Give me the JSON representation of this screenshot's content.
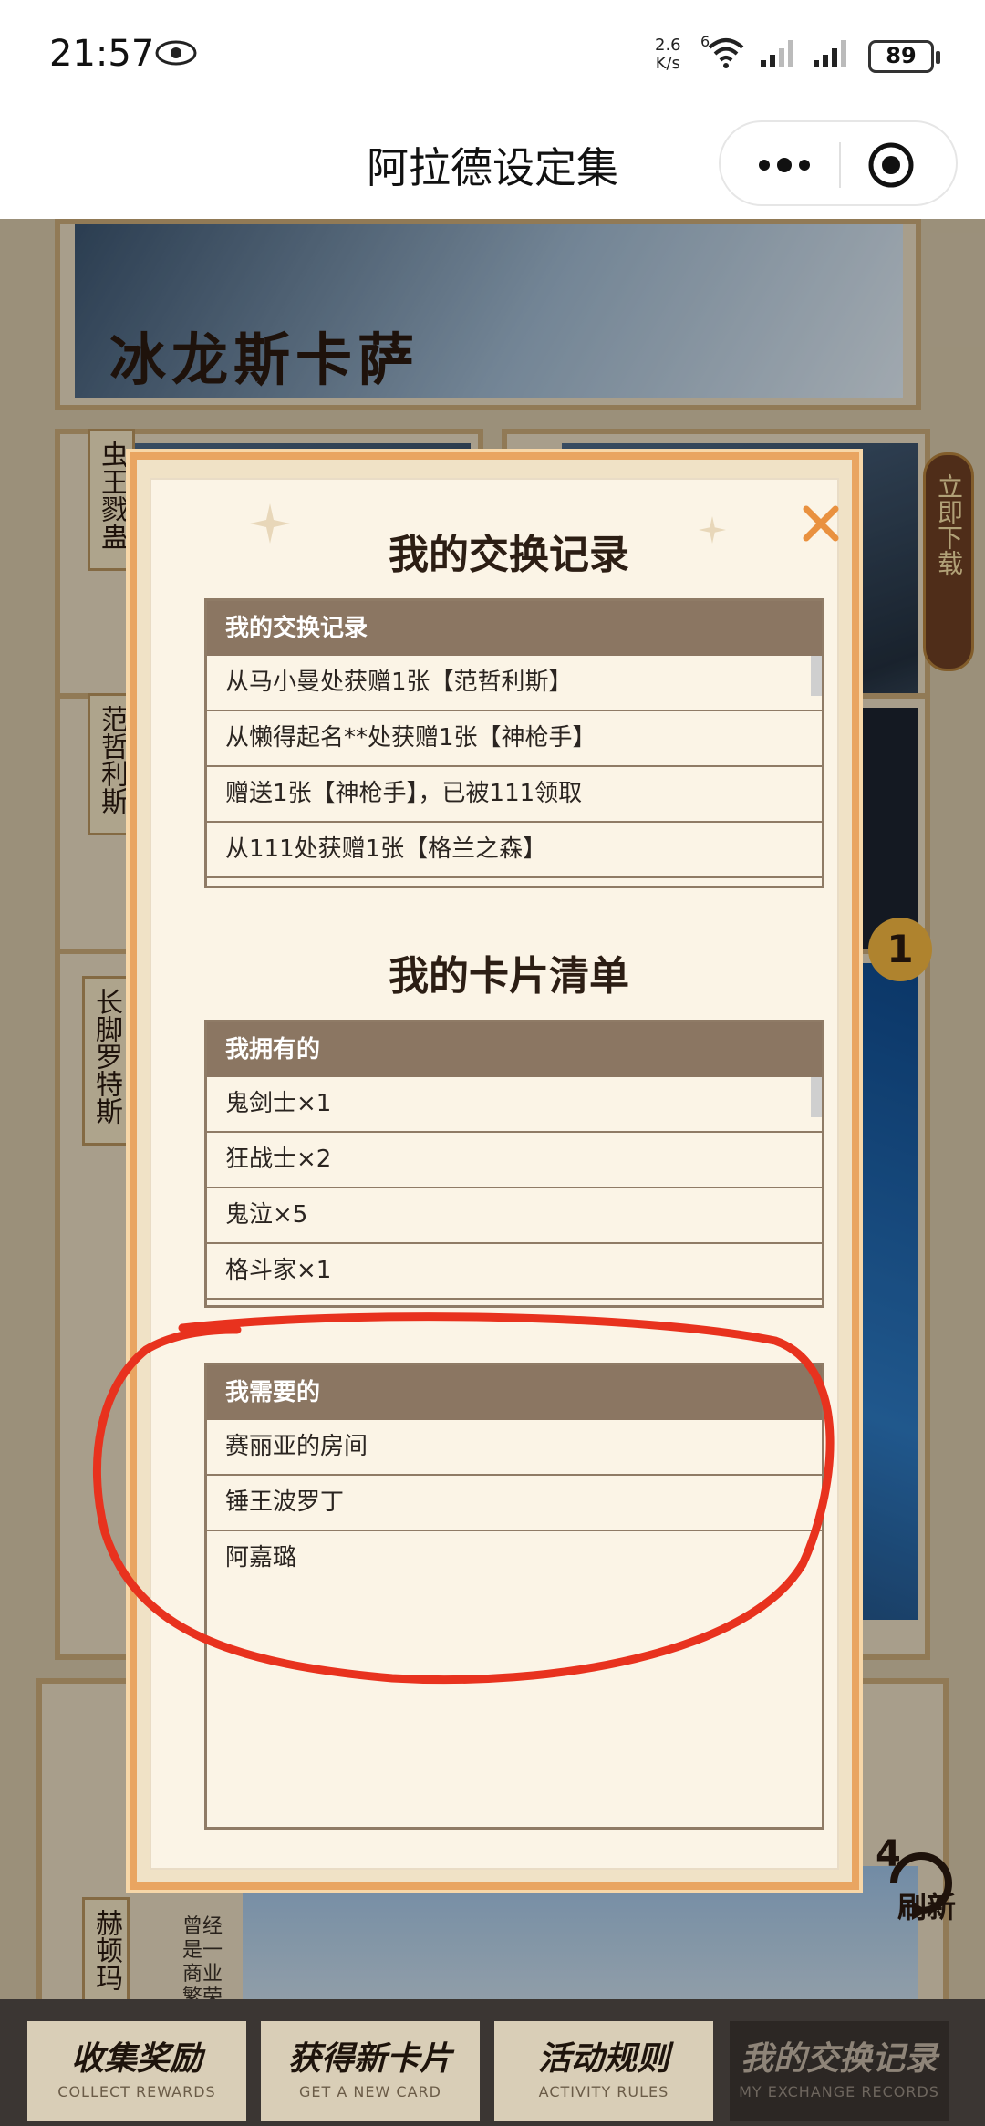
{
  "status_bar": {
    "time": "21:57",
    "net_speed_value": "2.6",
    "net_speed_unit": "K/s",
    "wifi_badge": "6",
    "battery": "89"
  },
  "nav": {
    "title": "阿拉德设定集",
    "more_icon": "more-dots-icon",
    "close_icon": "target-circle-icon"
  },
  "background": {
    "banner_title": "冰龙斯卡萨",
    "card_labels": [
      "虫王戮蛊",
      "范哲利斯",
      "长脚罗特斯",
      "赫顿玛"
    ],
    "side_download": "立即下载",
    "badge_count": "1",
    "refresh_count": "4",
    "refresh_label": "刷新",
    "bottom_text": "曾经是一 商业繁荣"
  },
  "modal": {
    "exchange_title": "我的交换记录",
    "exchange_panel_header": "我的交换记录",
    "exchange_records": [
      "从马小曼处获赠1张【范哲利斯】",
      "从懒得起名**处获赠1张【神枪手】",
      "赠送1张【神枪手】，已被111领取",
      "从111处获赠1张【格兰之森】"
    ],
    "cards_title": "我的卡片清单",
    "owned_header": "我拥有的",
    "owned": [
      "鬼剑士×1",
      "狂战士×2",
      "鬼泣×5",
      "格斗家×1"
    ],
    "needed_header": "我需要的",
    "needed": [
      "赛丽亚的房间",
      "锤王波罗丁",
      "阿嘉璐"
    ]
  },
  "tabs": [
    {
      "cn": "收集奖励",
      "en": "COLLECT REWARDS"
    },
    {
      "cn": "获得新卡片",
      "en": "GET A NEW CARD"
    },
    {
      "cn": "活动规则",
      "en": "ACTIVITY RULES"
    },
    {
      "cn": "我的交换记录",
      "en": "MY EXCHANGE RECORDS"
    }
  ],
  "colors": {
    "modal_border": "#e9a561",
    "panel_header": "#8b7662",
    "annotation": "#e8321e"
  }
}
